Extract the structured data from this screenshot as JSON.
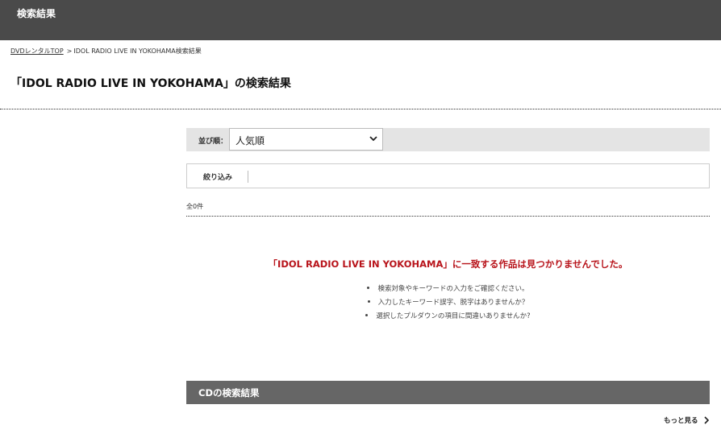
{
  "header": {
    "title": "検索結果"
  },
  "breadcrumb": {
    "home_label": "DVDレンタルTOP",
    "separator": ">",
    "current": "IDOL RADIO LIVE IN YOKOHAMA検索結果"
  },
  "page_title": "「IDOL RADIO LIVE IN YOKOHAMA」の検索結果",
  "sort": {
    "label": "並び順：",
    "selected": "人気順"
  },
  "filter": {
    "label": "絞り込み"
  },
  "result_count": "全0件",
  "no_results": {
    "message": "「IDOL RADIO LIVE IN YOKOHAMA」に一致する作品は見つかりませんでした。",
    "tips": [
      "検索対象やキーワードの入力をご確認ください。",
      "入力したキーワード誤字、脱字はありませんか？",
      "選択したプルダウンの項目に間違いありませんか?"
    ]
  },
  "cd_section": {
    "title": "CDの検索結果",
    "more_label": "もっと見る"
  },
  "icons": {
    "sort_dropdown": "chevron-down-icon",
    "more": "chevron-right-icon"
  },
  "colors": {
    "header_bg": "#4a4a4a",
    "error_text": "#b8141b",
    "section_bar": "#666666"
  }
}
